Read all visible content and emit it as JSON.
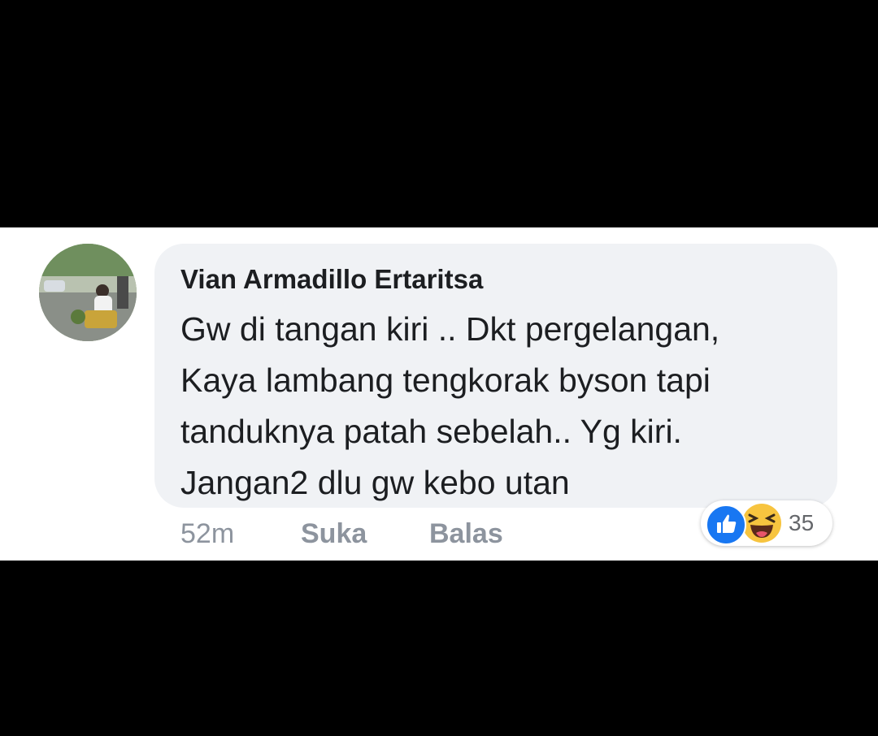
{
  "comment": {
    "author": "Vian Armadillo Ertaritsa",
    "lines": [
      "Gw di tangan kiri ..  Dkt pergelangan,",
      "Kaya lambang tengkorak byson tapi",
      "tanduknya patah sebelah..  Yg kiri.",
      "Jangan2 dlu gw kebo utan"
    ],
    "time": "52m",
    "like_label": "Suka",
    "reply_label": "Balas",
    "reactions": {
      "icons": [
        "thumbs-up-icon",
        "haha-laughing-icon"
      ],
      "count": "35"
    }
  },
  "colors": {
    "background_bars": "#000000",
    "panel": "#ffffff",
    "bubble": "#f0f2f5",
    "text": "#1c1e21",
    "meta_text": "#8d949e",
    "like_blue": "#1877f2",
    "haha_yellow": "#f7c43f"
  }
}
